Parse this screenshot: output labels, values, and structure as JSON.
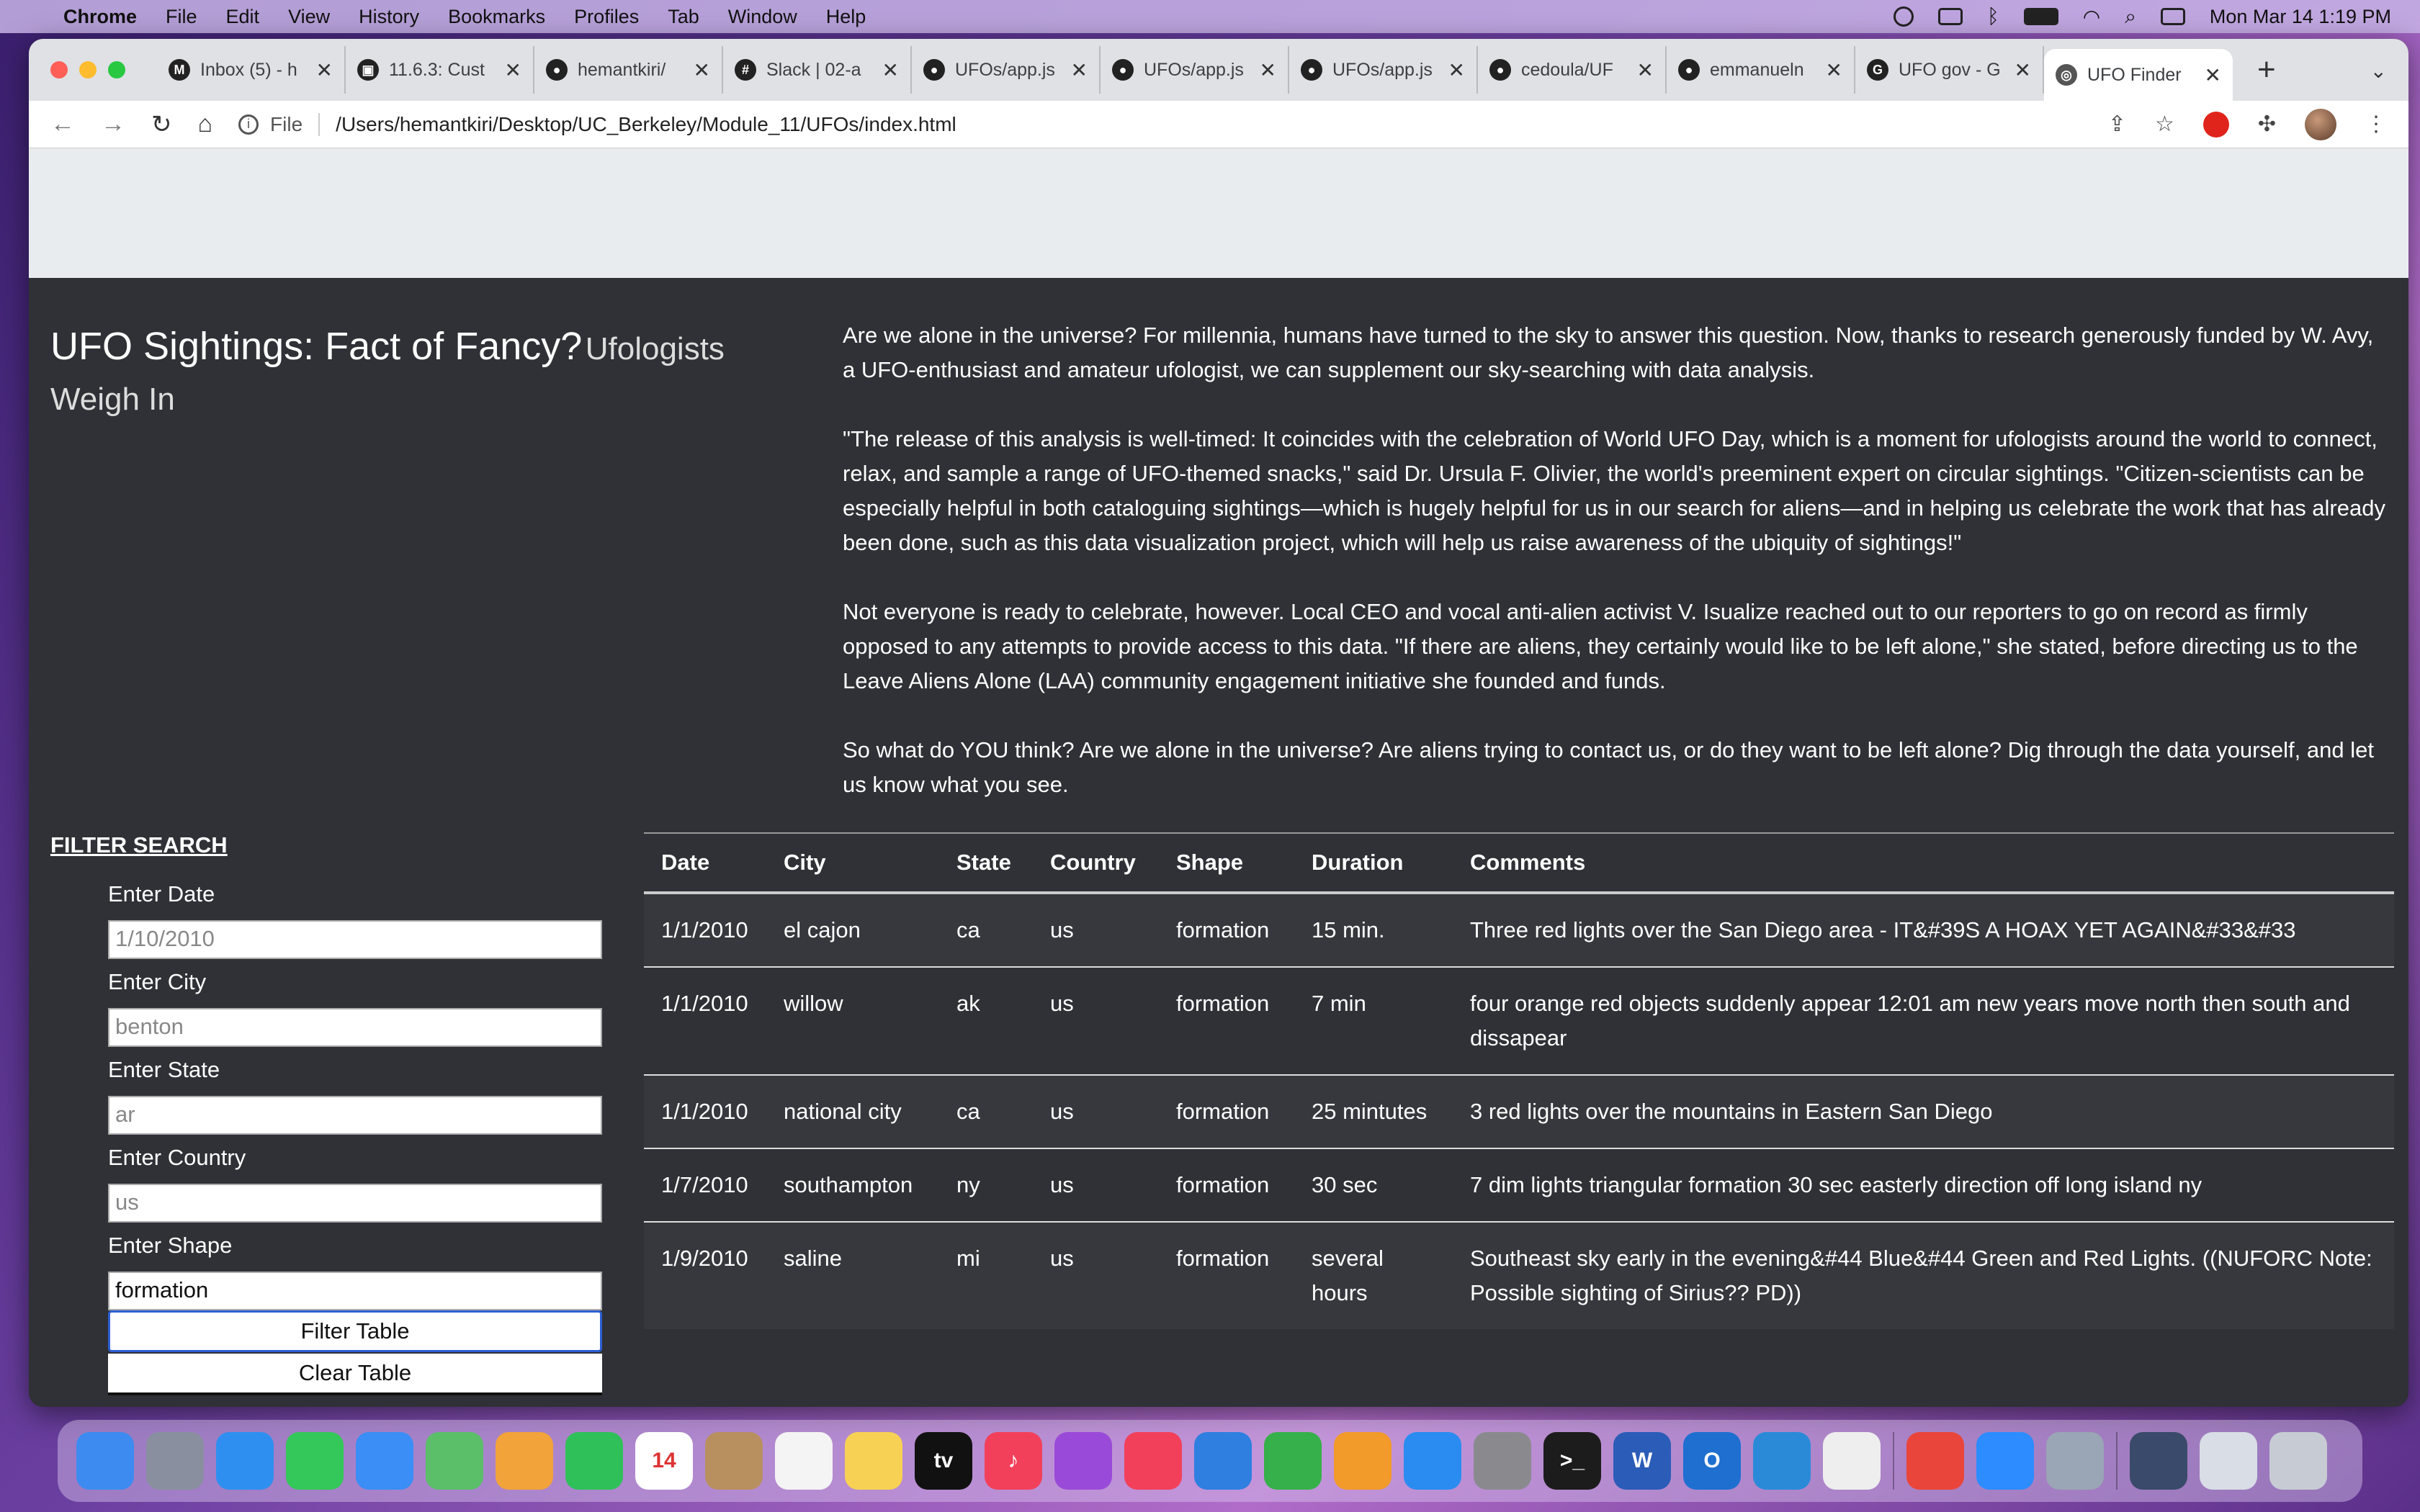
{
  "menubar": {
    "app": "Chrome",
    "items": [
      "File",
      "Edit",
      "View",
      "History",
      "Bookmarks",
      "Profiles",
      "Tab",
      "Window",
      "Help"
    ],
    "clock": "Mon Mar 14  1:19 PM"
  },
  "tabs": [
    {
      "label": "Inbox (5) - h",
      "icon": "gmail-icon",
      "glyph": "M"
    },
    {
      "label": "11.6.3: Cust",
      "icon": "bootcamp-icon",
      "glyph": "▣"
    },
    {
      "label": "hemantkiri/",
      "icon": "github-icon",
      "glyph": "●"
    },
    {
      "label": "Slack | 02-a",
      "icon": "slack-icon",
      "glyph": "#"
    },
    {
      "label": "UFOs/app.js",
      "icon": "github-icon",
      "glyph": "●"
    },
    {
      "label": "UFOs/app.js",
      "icon": "github-icon",
      "glyph": "●"
    },
    {
      "label": "UFOs/app.js",
      "icon": "github-icon",
      "glyph": "●"
    },
    {
      "label": "cedoula/UF",
      "icon": "github-icon",
      "glyph": "●"
    },
    {
      "label": "emmanueln",
      "icon": "github-icon",
      "glyph": "●"
    },
    {
      "label": "UFO gov - G",
      "icon": "google-icon",
      "glyph": "G"
    }
  ],
  "active_tab": {
    "label": "UFO Finder",
    "icon": "globe-icon"
  },
  "address": {
    "scheme": "File",
    "url": "/Users/hemantkiri/Desktop/UC_Berkeley/Module_11/UFOs/index.html"
  },
  "header": {
    "title": "UFO Sightings: Fact of Fancy?",
    "subtitle": "Ufologists Weigh In"
  },
  "intro": [
    "Are we alone in the universe? For millennia, humans have turned to the sky to answer this question. Now, thanks to research generously funded by W. Avy, a UFO-enthusiast and amateur ufologist, we can supplement our sky-searching with data analysis.",
    "\"The release of this analysis is well-timed: It coincides with the celebration of World UFO Day, which is a moment for ufologists around the world to connect, relax, and sample a range of UFO-themed snacks,\" said Dr. Ursula F. Olivier, the world's preeminent expert on circular sightings. \"Citizen-scientists can be especially helpful in both cataloguing sightings—which is hugely helpful for us in our search for aliens—and in helping us celebrate the work that has already been done, such as this data visualization project, which will help us raise awareness of the ubiquity of sightings!\"",
    "Not everyone is ready to celebrate, however. Local CEO and vocal anti-alien activist V. Isualize reached out to our reporters to go on record as firmly opposed to any attempts to provide access to this data. \"If there are aliens, they certainly would like to be left alone,\" she stated, before directing us to the Leave Aliens Alone (LAA) community engagement initiative she founded and funds.",
    "So what do YOU think? Are we alone in the universe? Are aliens trying to contact us, or do they want to be left alone? Dig through the data yourself, and let us know what you see."
  ],
  "filter": {
    "title": "FILTER SEARCH",
    "date_label": "Enter Date",
    "date_placeholder": "1/10/2010",
    "city_label": "Enter City",
    "city_placeholder": "benton",
    "state_label": "Enter State",
    "state_placeholder": "ar",
    "country_label": "Enter Country",
    "country_placeholder": "us",
    "shape_label": "Enter Shape",
    "shape_value": "formation",
    "filter_button": "Filter Table",
    "clear_button": "Clear Table"
  },
  "table": {
    "columns": [
      "Date",
      "City",
      "State",
      "Country",
      "Shape",
      "Duration",
      "Comments"
    ],
    "rows": [
      [
        "1/1/2010",
        "el cajon",
        "ca",
        "us",
        "formation",
        "15 min.",
        "Three red lights over the San Diego area - IT&#39S A HOAX YET AGAIN&#33&#33"
      ],
      [
        "1/1/2010",
        "willow",
        "ak",
        "us",
        "formation",
        "7 min",
        "four orange red objects suddenly appear 12:01 am new years move north then south and dissapear"
      ],
      [
        "1/1/2010",
        "national city",
        "ca",
        "us",
        "formation",
        "25 mintutes",
        "3 red lights over the mountains in Eastern San Diego"
      ],
      [
        "1/7/2010",
        "southampton",
        "ny",
        "us",
        "formation",
        "30 sec",
        "7 dim lights triangular formation 30 sec easterly direction off long island ny"
      ],
      [
        "1/9/2010",
        "saline",
        "mi",
        "us",
        "formation",
        "several hours",
        "Southeast sky early in the evening&#44 Blue&#44 Green and Red Lights. ((NUFORC Note: Possible sighting of Sirius?? PD))"
      ]
    ]
  },
  "dock": [
    {
      "name": "finder-icon",
      "color": "#3d8bf0"
    },
    {
      "name": "launchpad-icon",
      "color": "#8a8fa0"
    },
    {
      "name": "safari-icon",
      "color": "#2f8ff0"
    },
    {
      "name": "messages-icon",
      "color": "#34c759"
    },
    {
      "name": "mail-icon",
      "color": "#3a8ef5"
    },
    {
      "name": "maps-icon",
      "color": "#5bbf6a"
    },
    {
      "name": "photos-icon",
      "color": "#f2a33a"
    },
    {
      "name": "facetime-icon",
      "color": "#30c05a"
    },
    {
      "name": "calendar-icon",
      "color": "#ffffff",
      "text": "14"
    },
    {
      "name": "contacts-icon",
      "color": "#b89060"
    },
    {
      "name": "reminders-icon",
      "color": "#f4f4f4"
    },
    {
      "name": "notes-icon",
      "color": "#f7d154"
    },
    {
      "name": "appletv-icon",
      "color": "#111111",
      "text": "tv"
    },
    {
      "name": "music-icon",
      "color": "#f2405a",
      "text": "♪"
    },
    {
      "name": "podcasts-icon",
      "color": "#9a4ad8"
    },
    {
      "name": "news-icon",
      "color": "#f2405a"
    },
    {
      "name": "keynote-icon",
      "color": "#2f7fe0"
    },
    {
      "name": "numbers-icon",
      "color": "#36b04a"
    },
    {
      "name": "pages-icon",
      "color": "#f29a2a"
    },
    {
      "name": "appstore-icon",
      "color": "#2a8cf0"
    },
    {
      "name": "system-preferences-icon",
      "color": "#8a8a8e"
    },
    {
      "name": "terminal-icon",
      "color": "#1c1c1c",
      "text": ">_"
    },
    {
      "name": "word-icon",
      "color": "#2b5cb8",
      "text": "W"
    },
    {
      "name": "outlook-icon",
      "color": "#1f6fd1",
      "text": "O"
    },
    {
      "name": "vscode-icon",
      "color": "#2a8ad8"
    },
    {
      "name": "textedit-icon",
      "color": "#eeeeee"
    },
    {
      "name": "chrome-icon",
      "color": "#e9453a"
    },
    {
      "name": "zoom-icon",
      "color": "#2d8cff"
    },
    {
      "name": "preview-icon",
      "color": "#9aa5b5"
    },
    {
      "name": "screenshot-icon",
      "color": "#3a4a6a"
    },
    {
      "name": "documents-icon",
      "color": "#d8dde6"
    },
    {
      "name": "trash-icon",
      "color": "#c7ccd4"
    }
  ]
}
